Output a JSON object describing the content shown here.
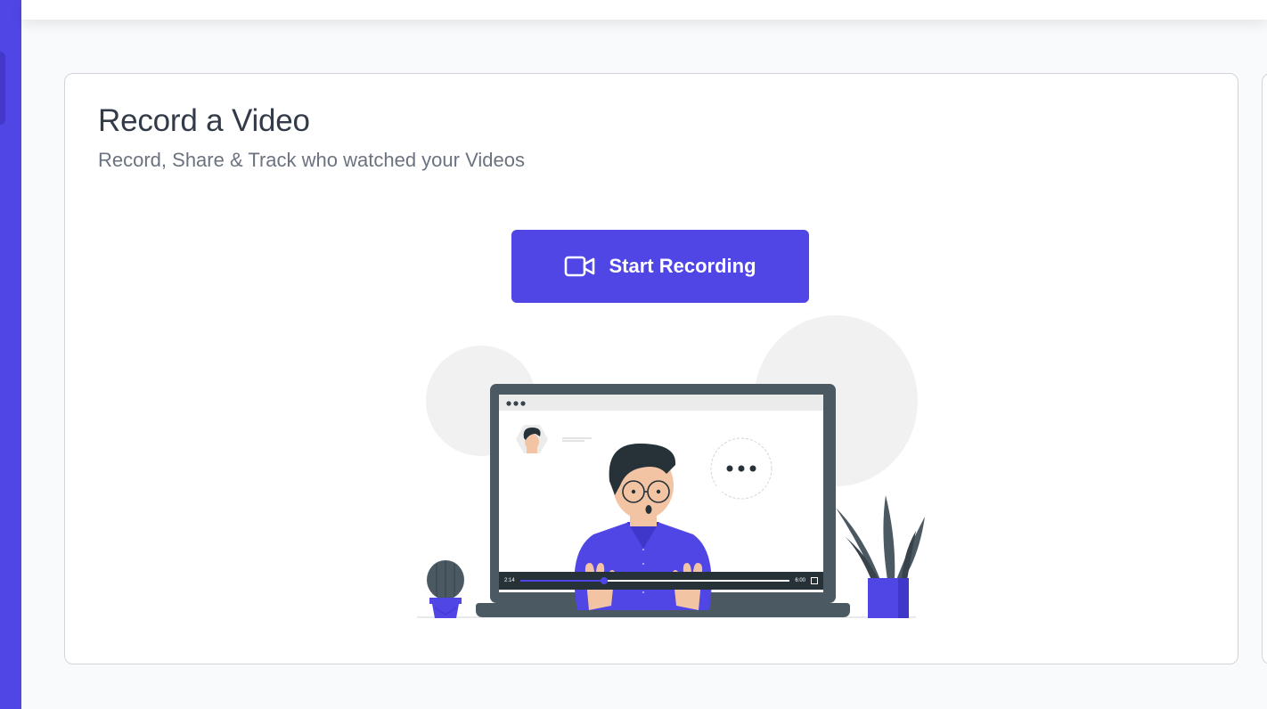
{
  "card": {
    "title": "Record a Video",
    "subtitle": "Record, Share & Track who watched your Videos",
    "start_button_label": "Start Recording",
    "button_icon": "video-camera-icon"
  },
  "illustration": {
    "player_time_elapsed": "2:14",
    "player_time_total": "6:00",
    "player_progress_fraction": 0.31
  },
  "colors": {
    "accent": "#4f46e5",
    "title_text": "#333a48",
    "subtitle_text": "#6b7280",
    "laptop_frame": "#4b5963"
  }
}
